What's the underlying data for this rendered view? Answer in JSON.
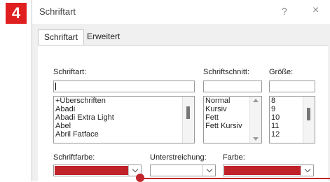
{
  "step_badge": "4",
  "dialog": {
    "title": "Schriftart",
    "help": "?",
    "close": "×"
  },
  "tabs": [
    {
      "label": "Schriftart",
      "active": true
    },
    {
      "label": "Erweitert",
      "active": false
    }
  ],
  "font": {
    "label": "Schriftart:",
    "value": "",
    "items": [
      "+Überschriften",
      "Abadi",
      "Abadi Extra Light",
      "Abel",
      "Abril Fatface"
    ]
  },
  "style": {
    "label": "Schriftschnitt:",
    "value": "",
    "items": [
      "Normal",
      "Kursiv",
      "Fett",
      "Fett Kursiv"
    ]
  },
  "size": {
    "label": "Größe:",
    "value": "",
    "items": [
      "8",
      "9",
      "10",
      "11",
      "12"
    ]
  },
  "font_color": {
    "label": "Schriftfarbe:",
    "color": "#c0222a"
  },
  "underline": {
    "label": "Unterstreichung:",
    "value": ""
  },
  "underline_color": {
    "label": "Farbe:",
    "color": "#c0222a"
  },
  "colors": {
    "badge": "#e02020",
    "callout": "#c0282d"
  }
}
